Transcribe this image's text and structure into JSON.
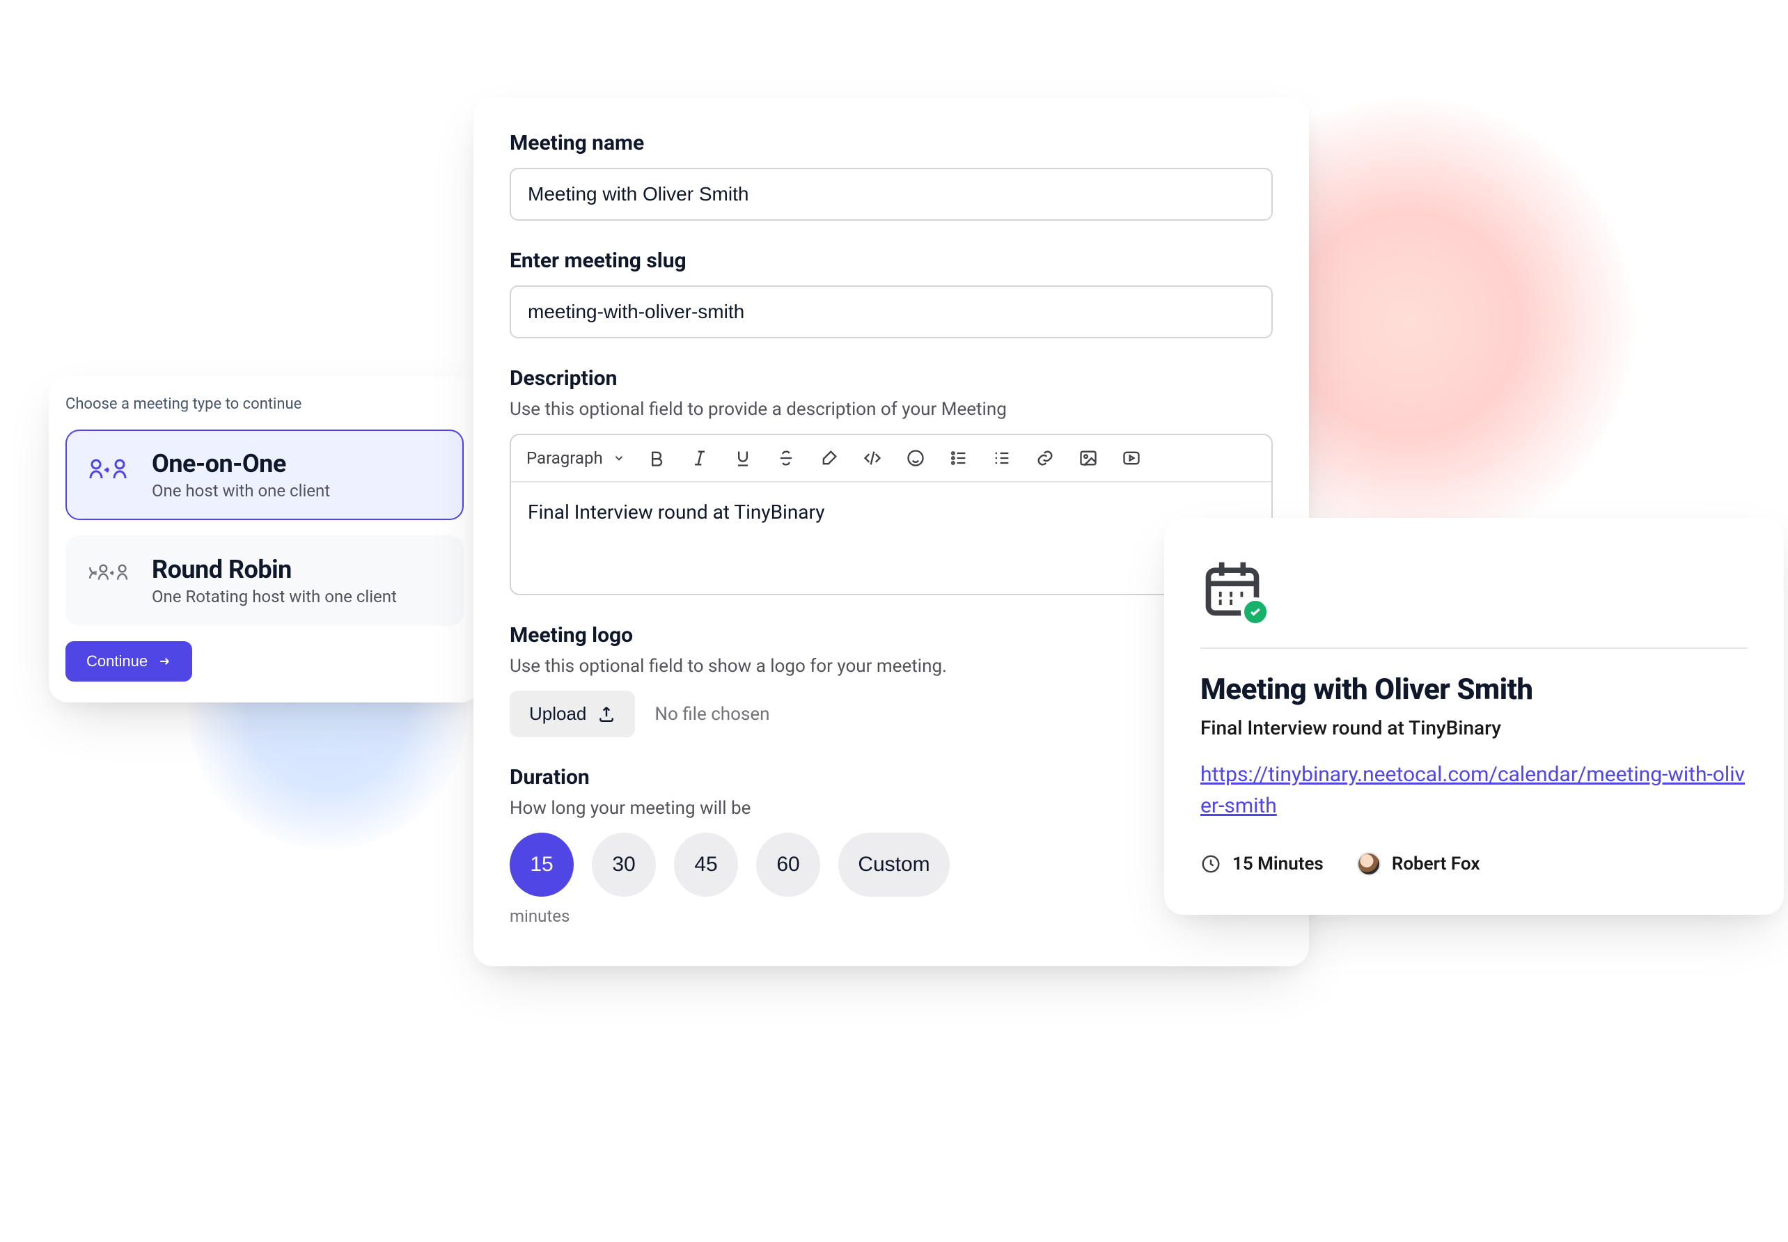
{
  "types_card": {
    "prompt": "Choose a meeting type to continue",
    "options": [
      {
        "title": "One-on-One",
        "subtitle": "One host with one client",
        "selected": true
      },
      {
        "title": "Round Robin",
        "subtitle": "One Rotating host with one client",
        "selected": false
      }
    ],
    "continue_label": "Continue"
  },
  "form": {
    "name_label": "Meeting name",
    "name_value": "Meeting with Oliver Smith",
    "slug_label": "Enter meeting slug",
    "slug_value": "meeting-with-oliver-smith",
    "desc_label": "Description",
    "desc_help": "Use this optional field to provide a description of your Meeting",
    "desc_value": "Final Interview round at TinyBinary",
    "paragraph_selector": "Paragraph",
    "logo_label": "Meeting logo",
    "logo_help": "Use this optional field to show a logo for your meeting.",
    "upload_label": "Upload",
    "upload_status": "No file chosen",
    "dur_label": "Duration",
    "dur_help": "How long your meeting will be",
    "dur_options": [
      {
        "label": "15",
        "active": true
      },
      {
        "label": "30",
        "active": false
      },
      {
        "label": "45",
        "active": false
      },
      {
        "label": "60",
        "active": false
      },
      {
        "label": "Custom",
        "active": false
      }
    ],
    "dur_unit": "minutes"
  },
  "share": {
    "title": "Meeting with Oliver Smith",
    "subtitle": "Final Interview round at TinyBinary",
    "url": "https://tinybinary.neetocal.com/calendar/meeting-with-oliver-smith",
    "duration": "15 Minutes",
    "host": "Robert Fox"
  }
}
